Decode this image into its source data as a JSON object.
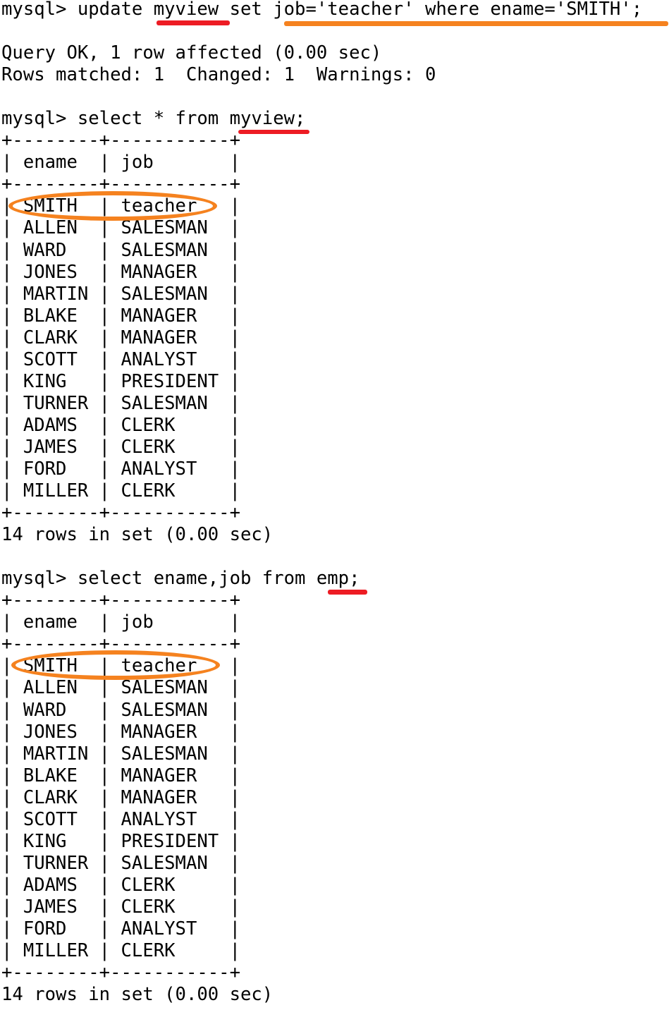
{
  "terminal": {
    "prompt": "mysql>",
    "colors": {
      "background": "#ffffff",
      "text": "#000000",
      "underline_red": "#ED1C24",
      "underline_orange": "#F5821F",
      "ellipse_orange": "#F5821F"
    },
    "blocks": [
      {
        "id": "block-1-update",
        "command": "mysql> update myview set job='teacher' where ename='SMITH';",
        "result_lines": [
          "Query OK, 1 row affected (0.00 sec)",
          "Rows matched: 1  Changed: 1  Warnings: 0"
        ]
      },
      {
        "id": "block-2-select-myview",
        "command": "mysql> select * from myview;",
        "table": {
          "columns": [
            "ename",
            "job"
          ],
          "border": "+--------+-----------+",
          "header_row": "| ename  | job       |",
          "rows": [
            [
              "SMITH",
              "teacher"
            ],
            [
              "ALLEN",
              "SALESMAN"
            ],
            [
              "WARD",
              "SALESMAN"
            ],
            [
              "JONES",
              "MANAGER"
            ],
            [
              "MARTIN",
              "SALESMAN"
            ],
            [
              "BLAKE",
              "MANAGER"
            ],
            [
              "CLARK",
              "MANAGER"
            ],
            [
              "SCOTT",
              "ANALYST"
            ],
            [
              "KING",
              "PRESIDENT"
            ],
            [
              "TURNER",
              "SALESMAN"
            ],
            [
              "ADAMS",
              "CLERK"
            ],
            [
              "JAMES",
              "CLERK"
            ],
            [
              "FORD",
              "ANALYST"
            ],
            [
              "MILLER",
              "CLERK"
            ]
          ]
        },
        "footer": "14 rows in set (0.00 sec)"
      },
      {
        "id": "block-3-select-emp",
        "command": "mysql> select ename,job from emp;",
        "table": {
          "columns": [
            "ename",
            "job"
          ],
          "border": "+--------+-----------+",
          "header_row": "| ename  | job       |",
          "rows": [
            [
              "SMITH",
              "teacher"
            ],
            [
              "ALLEN",
              "SALESMAN"
            ],
            [
              "WARD",
              "SALESMAN"
            ],
            [
              "JONES",
              "MANAGER"
            ],
            [
              "MARTIN",
              "SALESMAN"
            ],
            [
              "BLAKE",
              "MANAGER"
            ],
            [
              "CLARK",
              "MANAGER"
            ],
            [
              "SCOTT",
              "ANALYST"
            ],
            [
              "KING",
              "PRESIDENT"
            ],
            [
              "TURNER",
              "SALESMAN"
            ],
            [
              "ADAMS",
              "CLERK"
            ],
            [
              "JAMES",
              "CLERK"
            ],
            [
              "FORD",
              "ANALYST"
            ],
            [
              "MILLER",
              "CLERK"
            ]
          ]
        },
        "footer": "14 rows in set (0.00 sec)"
      }
    ],
    "full_text": "mysql> update myview set job='teacher' where ename='SMITH';\n\nQuery OK, 1 row affected (0.00 sec)\nRows matched: 1  Changed: 1  Warnings: 0\n\nmysql> select * from myview;\n+--------+-----------+\n| ename  | job       |\n+--------+-----------+\n| SMITH  | teacher   |\n| ALLEN  | SALESMAN  |\n| WARD   | SALESMAN  |\n| JONES  | MANAGER   |\n| MARTIN | SALESMAN  |\n| BLAKE  | MANAGER   |\n| CLARK  | MANAGER   |\n| SCOTT  | ANALYST   |\n| KING   | PRESIDENT |\n| TURNER | SALESMAN  |\n| ADAMS  | CLERK     |\n| JAMES  | CLERK     |\n| FORD   | ANALYST   |\n| MILLER | CLERK     |\n+--------+-----------+\n14 rows in set (0.00 sec)\n\nmysql> select ename,job from emp;\n+--------+-----------+\n| ename  | job       |\n+--------+-----------+\n| SMITH  | teacher   |\n| ALLEN  | SALESMAN  |\n| WARD   | SALESMAN  |\n| JONES  | MANAGER   |\n| MARTIN | SALESMAN  |\n| BLAKE  | MANAGER   |\n| CLARK  | MANAGER   |\n| SCOTT  | ANALYST   |\n| KING   | PRESIDENT |\n| TURNER | SALESMAN  |\n| ADAMS  | CLERK     |\n| JAMES  | CLERK     |\n| FORD   | ANALYST   |\n| MILLER | CLERK     |\n+--------+-----------+\n14 rows in set (0.00 sec)"
  },
  "annotations": {
    "underline_myview_update": {
      "label": "myview",
      "color": "#ED1C24"
    },
    "underline_set_clause": {
      "label": "job='teacher' where ename='SMITH';",
      "color": "#F5821F"
    },
    "underline_myview_select": {
      "label": "myview",
      "color": "#ED1C24"
    },
    "underline_emp_select": {
      "label": "emp",
      "color": "#ED1C24"
    },
    "ellipse_smith_teacher_view": {
      "label": "SMITH | teacher",
      "color": "#F5821F"
    },
    "ellipse_smith_teacher_emp": {
      "label": "SMITH | teacher",
      "color": "#F5821F"
    }
  }
}
